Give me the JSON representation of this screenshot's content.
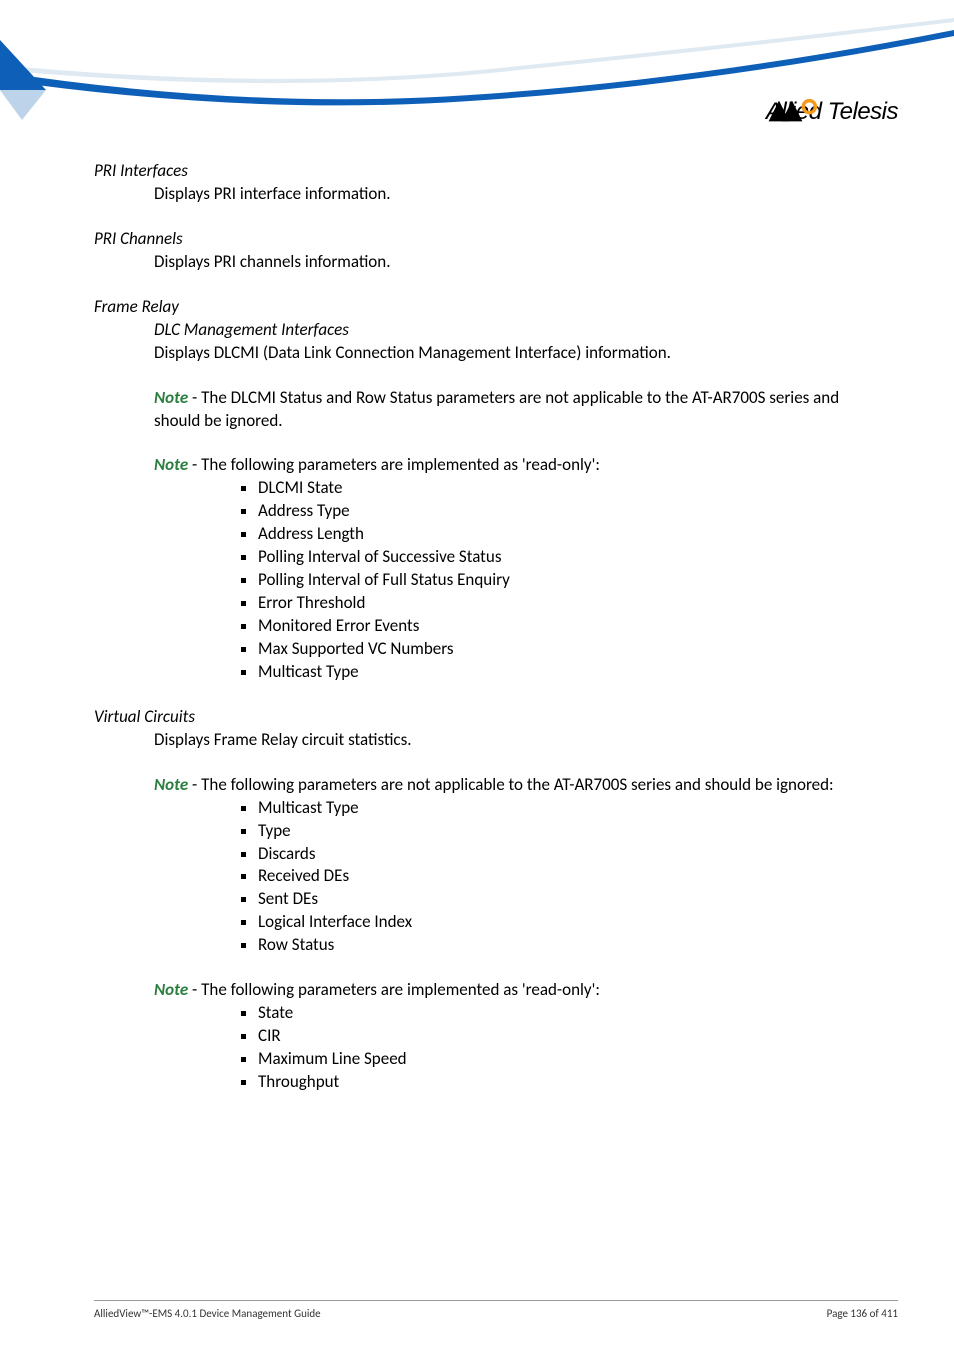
{
  "logo_text": "Allied Telesis",
  "sections": {
    "pri_interfaces": {
      "title": "PRI Interfaces",
      "body": "Displays PRI interface information."
    },
    "pri_channels": {
      "title": "PRI Channels",
      "body": "Displays PRI channels information."
    },
    "frame_relay": {
      "title": "Frame Relay",
      "subtitle": "DLC Management Interfaces",
      "body": "Displays DLCMI (Data Link Connection Management Interface) information.",
      "note1_label": "Note",
      "note1_body": " - The DLCMI Status and Row Status parameters are not applicable to the AT-AR700S series and should be ignored.",
      "note2_label": "Note",
      "note2_body": " - The following parameters are implemented as 'read-only':",
      "note2_items": [
        "DLCMI State",
        "Address Type",
        "Address Length",
        "Polling Interval of Successive Status",
        "Polling Interval of Full Status Enquiry",
        "Error Threshold",
        "Monitored Error Events",
        "Max Supported VC Numbers",
        "Multicast Type"
      ]
    },
    "virtual_circuits": {
      "title": "Virtual Circuits",
      "body": "Displays Frame Relay circuit statistics.",
      "note1_label": "Note",
      "note1_body": " - The following parameters are not applicable to the AT-AR700S series and should be ignored:",
      "note1_items": [
        "Multicast Type",
        "Type",
        "Discards",
        "Received DEs",
        "Sent DEs",
        "Logical Interface Index",
        "Row Status"
      ],
      "note2_label": "Note",
      "note2_body": " - The following parameters are implemented as 'read-only':",
      "note2_items": [
        "State",
        "CIR",
        "Maximum Line Speed",
        "Throughput"
      ]
    }
  },
  "footer": {
    "left": "AlliedView™-EMS 4.0.1 Device Management Guide",
    "right": "Page 136 of 411"
  }
}
